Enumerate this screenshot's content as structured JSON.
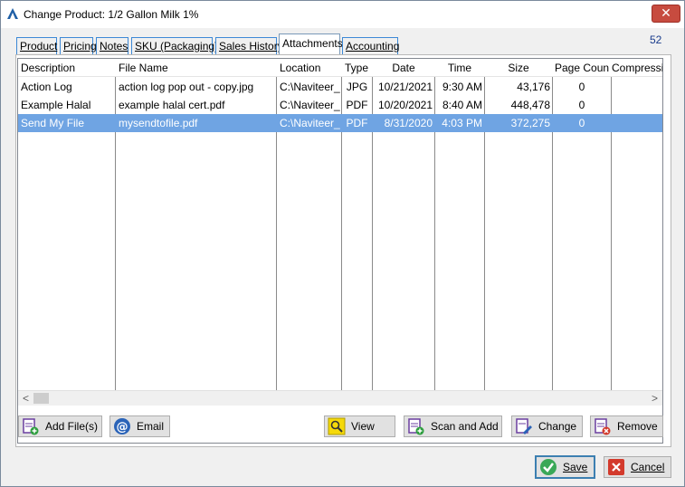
{
  "window": {
    "title": "Change Product: 1/2 Gallon Milk 1%",
    "close_glyph": "✕"
  },
  "tabs": [
    {
      "label": "Product"
    },
    {
      "label": "Pricing"
    },
    {
      "label": "Notes"
    },
    {
      "label": "SKU (Packaging)"
    },
    {
      "label": "Sales History"
    },
    {
      "label": "Attachments",
      "active": true
    },
    {
      "label": "Accounting"
    }
  ],
  "record_count": "52",
  "grid": {
    "columns": [
      "Description",
      "File Name",
      "Location",
      "Type",
      "Date",
      "Time",
      "Size",
      "Page Count",
      "Compression"
    ],
    "rows": [
      [
        "Action Log",
        "action log pop out - copy.jpg",
        "C:\\Naviteer_B",
        "JPG",
        "10/21/2021",
        "9:30 AM",
        "43,176",
        "0",
        ""
      ],
      [
        "Example Halal",
        "example halal cert.pdf",
        "C:\\Naviteer_B",
        "PDF",
        "10/20/2021",
        "8:40 AM",
        "448,478",
        "0",
        ""
      ],
      [
        "Send My File",
        "mysendtofile.pdf",
        "C:\\Naviteer_B",
        "PDF",
        "8/31/2020",
        "4:03 PM",
        "372,275",
        "0",
        ""
      ]
    ],
    "selected_row": 2,
    "scroll_left": "<",
    "scroll_right": ">"
  },
  "buttons": {
    "add_files": "Add File(s)",
    "email": "Email",
    "view": "View",
    "scan_and_add": "Scan and Add",
    "change": "Change",
    "remove": "Remove",
    "save": "Save",
    "cancel": "Cancel"
  },
  "icons": {
    "app": "app-logo-icon",
    "add_files": "file-add-icon",
    "email": "at-sign-icon",
    "view": "magnifier-icon",
    "scan_and_add": "scanner-add-icon",
    "change": "file-edit-icon",
    "remove": "file-remove-icon",
    "save": "checkmark-icon",
    "cancel": "x-icon"
  },
  "colors": {
    "selection": "#6fa4e3",
    "close_button": "#c74b3f",
    "tab_border": "#3d89d6",
    "record_count": "#1a3c8c"
  }
}
